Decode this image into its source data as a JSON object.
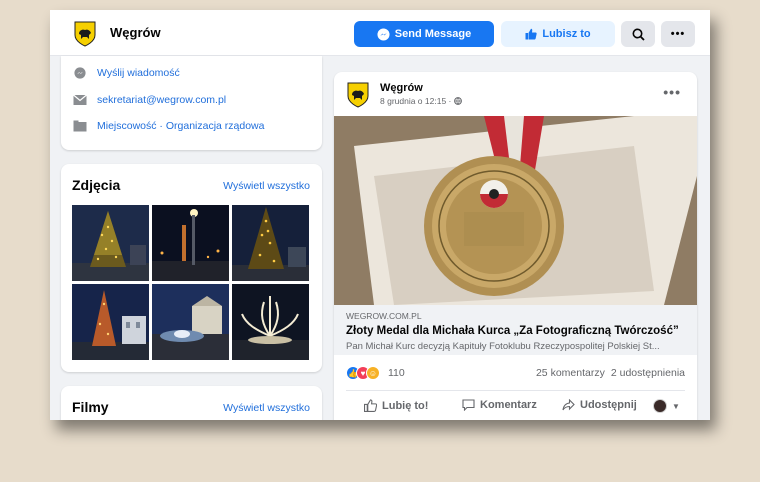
{
  "header": {
    "page_name": "Węgrów",
    "send_message_label": "Send Message",
    "like_label": "Lubisz to"
  },
  "about": {
    "items": [
      {
        "label": "Wyślij wiadomość",
        "icon": "messenger-icon"
      },
      {
        "label": "sekretariat@wegrow.com.pl",
        "icon": "mail-icon"
      },
      {
        "label": "Miejscowość · Organizacja rządowa",
        "icon": "category-icon"
      }
    ]
  },
  "photos": {
    "title": "Zdjęcia",
    "see_all": "Wyświetl wszystko"
  },
  "films": {
    "title": "Filmy",
    "see_all": "Wyświetl wszystko"
  },
  "post": {
    "author": "Węgrów",
    "date": "8 grudnia o 12:15 ·",
    "link": {
      "domain": "WEGROW.COM.PL",
      "title": "Złoty Medal dla Michała Kurca „Za Fotograficzną Twórczość”",
      "description": "Pan Michał Kurc decyzją Kapituły Fotoklubu Rzeczypospolitej Polskiej St..."
    },
    "reactions_count": "110",
    "comments": "25 komentarzy",
    "shares": "2 udostępnienia",
    "actions": {
      "like": "Lubię to!",
      "comment": "Komentarz",
      "share": "Udostępnij"
    }
  },
  "colors": {
    "accent": "#1877f2",
    "accent_light": "#e7f3ff",
    "background": "#f0f2f5",
    "link": "#216fdb"
  }
}
